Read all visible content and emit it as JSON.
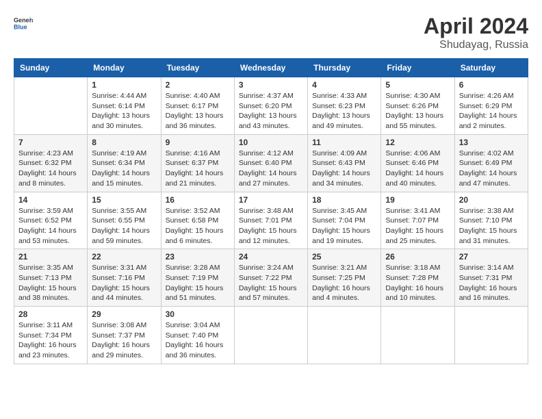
{
  "header": {
    "logo": {
      "general": "General",
      "blue": "Blue"
    },
    "title": "April 2024",
    "location": "Shudayag, Russia"
  },
  "calendar": {
    "days_of_week": [
      "Sunday",
      "Monday",
      "Tuesday",
      "Wednesday",
      "Thursday",
      "Friday",
      "Saturday"
    ],
    "weeks": [
      [
        {
          "day": "",
          "info": ""
        },
        {
          "day": "1",
          "info": "Sunrise: 4:44 AM\nSunset: 6:14 PM\nDaylight: 13 hours\nand 30 minutes."
        },
        {
          "day": "2",
          "info": "Sunrise: 4:40 AM\nSunset: 6:17 PM\nDaylight: 13 hours\nand 36 minutes."
        },
        {
          "day": "3",
          "info": "Sunrise: 4:37 AM\nSunset: 6:20 PM\nDaylight: 13 hours\nand 43 minutes."
        },
        {
          "day": "4",
          "info": "Sunrise: 4:33 AM\nSunset: 6:23 PM\nDaylight: 13 hours\nand 49 minutes."
        },
        {
          "day": "5",
          "info": "Sunrise: 4:30 AM\nSunset: 6:26 PM\nDaylight: 13 hours\nand 55 minutes."
        },
        {
          "day": "6",
          "info": "Sunrise: 4:26 AM\nSunset: 6:29 PM\nDaylight: 14 hours\nand 2 minutes."
        }
      ],
      [
        {
          "day": "7",
          "info": "Sunrise: 4:23 AM\nSunset: 6:32 PM\nDaylight: 14 hours\nand 8 minutes."
        },
        {
          "day": "8",
          "info": "Sunrise: 4:19 AM\nSunset: 6:34 PM\nDaylight: 14 hours\nand 15 minutes."
        },
        {
          "day": "9",
          "info": "Sunrise: 4:16 AM\nSunset: 6:37 PM\nDaylight: 14 hours\nand 21 minutes."
        },
        {
          "day": "10",
          "info": "Sunrise: 4:12 AM\nSunset: 6:40 PM\nDaylight: 14 hours\nand 27 minutes."
        },
        {
          "day": "11",
          "info": "Sunrise: 4:09 AM\nSunset: 6:43 PM\nDaylight: 14 hours\nand 34 minutes."
        },
        {
          "day": "12",
          "info": "Sunrise: 4:06 AM\nSunset: 6:46 PM\nDaylight: 14 hours\nand 40 minutes."
        },
        {
          "day": "13",
          "info": "Sunrise: 4:02 AM\nSunset: 6:49 PM\nDaylight: 14 hours\nand 47 minutes."
        }
      ],
      [
        {
          "day": "14",
          "info": "Sunrise: 3:59 AM\nSunset: 6:52 PM\nDaylight: 14 hours\nand 53 minutes."
        },
        {
          "day": "15",
          "info": "Sunrise: 3:55 AM\nSunset: 6:55 PM\nDaylight: 14 hours\nand 59 minutes."
        },
        {
          "day": "16",
          "info": "Sunrise: 3:52 AM\nSunset: 6:58 PM\nDaylight: 15 hours\nand 6 minutes."
        },
        {
          "day": "17",
          "info": "Sunrise: 3:48 AM\nSunset: 7:01 PM\nDaylight: 15 hours\nand 12 minutes."
        },
        {
          "day": "18",
          "info": "Sunrise: 3:45 AM\nSunset: 7:04 PM\nDaylight: 15 hours\nand 19 minutes."
        },
        {
          "day": "19",
          "info": "Sunrise: 3:41 AM\nSunset: 7:07 PM\nDaylight: 15 hours\nand 25 minutes."
        },
        {
          "day": "20",
          "info": "Sunrise: 3:38 AM\nSunset: 7:10 PM\nDaylight: 15 hours\nand 31 minutes."
        }
      ],
      [
        {
          "day": "21",
          "info": "Sunrise: 3:35 AM\nSunset: 7:13 PM\nDaylight: 15 hours\nand 38 minutes."
        },
        {
          "day": "22",
          "info": "Sunrise: 3:31 AM\nSunset: 7:16 PM\nDaylight: 15 hours\nand 44 minutes."
        },
        {
          "day": "23",
          "info": "Sunrise: 3:28 AM\nSunset: 7:19 PM\nDaylight: 15 hours\nand 51 minutes."
        },
        {
          "day": "24",
          "info": "Sunrise: 3:24 AM\nSunset: 7:22 PM\nDaylight: 15 hours\nand 57 minutes."
        },
        {
          "day": "25",
          "info": "Sunrise: 3:21 AM\nSunset: 7:25 PM\nDaylight: 16 hours\nand 4 minutes."
        },
        {
          "day": "26",
          "info": "Sunrise: 3:18 AM\nSunset: 7:28 PM\nDaylight: 16 hours\nand 10 minutes."
        },
        {
          "day": "27",
          "info": "Sunrise: 3:14 AM\nSunset: 7:31 PM\nDaylight: 16 hours\nand 16 minutes."
        }
      ],
      [
        {
          "day": "28",
          "info": "Sunrise: 3:11 AM\nSunset: 7:34 PM\nDaylight: 16 hours\nand 23 minutes."
        },
        {
          "day": "29",
          "info": "Sunrise: 3:08 AM\nSunset: 7:37 PM\nDaylight: 16 hours\nand 29 minutes."
        },
        {
          "day": "30",
          "info": "Sunrise: 3:04 AM\nSunset: 7:40 PM\nDaylight: 16 hours\nand 36 minutes."
        },
        {
          "day": "",
          "info": ""
        },
        {
          "day": "",
          "info": ""
        },
        {
          "day": "",
          "info": ""
        },
        {
          "day": "",
          "info": ""
        }
      ]
    ]
  }
}
